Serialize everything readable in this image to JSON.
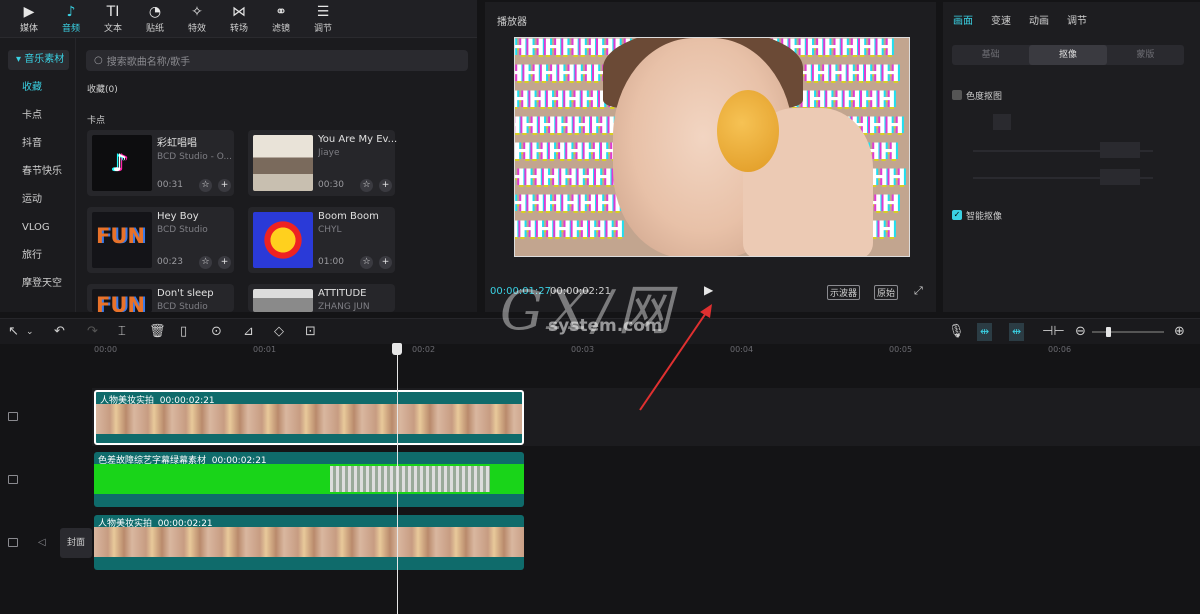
{
  "toolbar": {
    "items": [
      {
        "label": "媒体",
        "icon": "media-icon",
        "glyph": "▶"
      },
      {
        "label": "音频",
        "icon": "audio-icon",
        "glyph": "♪"
      },
      {
        "label": "文本",
        "icon": "text-icon",
        "glyph": "TI"
      },
      {
        "label": "贴纸",
        "icon": "sticker-icon",
        "glyph": "◔"
      },
      {
        "label": "特效",
        "icon": "effects-icon",
        "glyph": "✧"
      },
      {
        "label": "转场",
        "icon": "transition-icon",
        "glyph": "⋈"
      },
      {
        "label": "滤镜",
        "icon": "filter-icon",
        "glyph": "⚭"
      },
      {
        "label": "调节",
        "icon": "adjust-icon",
        "glyph": "☰"
      }
    ],
    "active_index": 1
  },
  "categories": {
    "header": "音乐素材",
    "items": [
      "收藏",
      "卡点",
      "抖音",
      "春节快乐",
      "运动",
      "VLOG",
      "旅行",
      "摩登天空"
    ]
  },
  "music": {
    "search_placeholder": "搜索歌曲名称/歌手",
    "favorites_label": "收藏(0)",
    "section_label": "卡点",
    "cards": [
      {
        "title": "彩虹唱唱",
        "artist": "BCD Studio - O...",
        "duration": "00:31"
      },
      {
        "title": "You Are My Ev...",
        "artist": "Jiaye",
        "duration": "00:30"
      },
      {
        "title": "Hey Boy",
        "artist": "BCD Studio",
        "duration": "00:23"
      },
      {
        "title": "Boom Boom",
        "artist": "CHYL",
        "duration": "01:00"
      },
      {
        "title": "Don't sleep",
        "artist": "BCD Studio",
        "duration": ""
      },
      {
        "title": "ATTITUDE",
        "artist": "ZHANG JUN",
        "duration": ""
      }
    ]
  },
  "player": {
    "title": "播放器",
    "current_time": "00:00:01:27",
    "total_time": "00:00:02:21",
    "scope_button": "示波器",
    "original_button": "原始",
    "video_pattern": "HHHHHHH"
  },
  "right_panel": {
    "tabs": [
      "画面",
      "变速",
      "动画",
      "调节"
    ],
    "segments": [
      "基础",
      "抠像",
      "蒙版"
    ],
    "chroma_key_label": "色度抠图",
    "smart_cutout_label": "智能抠像"
  },
  "timeline": {
    "ticks": [
      "00:00",
      "00:01",
      "00:02",
      "00:03",
      "00:04",
      "00:05",
      "00:06"
    ],
    "tracks": [
      {
        "name": "人物美妆实拍",
        "duration": "00:00:02:21"
      },
      {
        "name": "色差故障综艺字幕绿幕素材",
        "duration": "00:00:02:21"
      },
      {
        "name": "人物美妆实拍",
        "duration": "00:00:02:21"
      }
    ],
    "cover_label": "封面"
  },
  "watermark": {
    "main": "GX/网",
    "sub": "system.com"
  },
  "colors": {
    "accent": "#3ad1e3",
    "green_screen": "#19d419",
    "clip_teal": "#0f6b6b"
  }
}
